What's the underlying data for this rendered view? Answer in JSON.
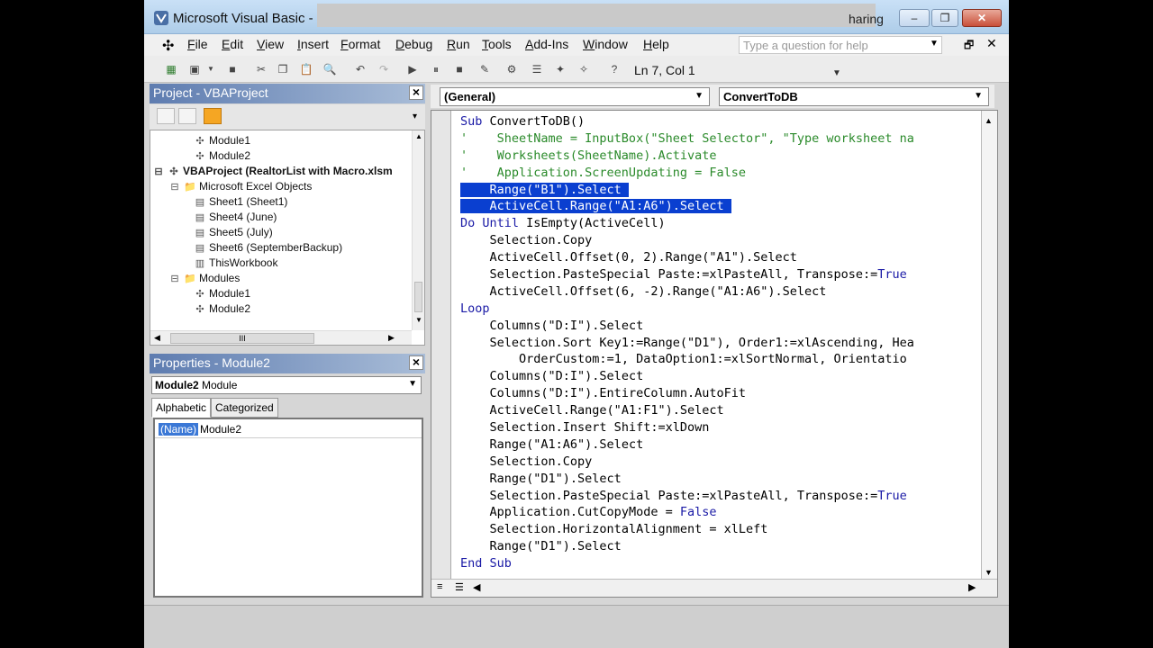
{
  "window": {
    "title": "Microsoft Visual Basic - R",
    "sharing_fragment": "haring",
    "minimize_label": "–",
    "maximize_label": "❐",
    "close_label": "✕"
  },
  "menu": {
    "items": [
      "File",
      "Edit",
      "View",
      "Insert",
      "Format",
      "Debug",
      "Run",
      "Tools",
      "Add-Ins",
      "Window",
      "Help"
    ],
    "help_placeholder": "Type a question for help"
  },
  "toolbar": {
    "cursor_position": "Ln 7, Col 1"
  },
  "project": {
    "title": "Project - VBAProject",
    "close_label": "×",
    "tree": [
      {
        "label": "Module1",
        "icon": "module-icon",
        "level": 3
      },
      {
        "label": "Module2",
        "icon": "module-icon",
        "level": 3
      },
      {
        "label": "VBAProject (RealtorList with Macro.xlsm",
        "icon": "vbaproject-icon",
        "level": 0,
        "bold": true,
        "expander": "⊟"
      },
      {
        "label": "Microsoft Excel Objects",
        "icon": "folder-icon",
        "level": 1,
        "expander": "⊟"
      },
      {
        "label": "Sheet1 (Sheet1)",
        "icon": "sheet-icon",
        "level": 2
      },
      {
        "label": "Sheet4 (June)",
        "icon": "sheet-icon",
        "level": 2
      },
      {
        "label": "Sheet5 (July)",
        "icon": "sheet-icon",
        "level": 2
      },
      {
        "label": "Sheet6 (SeptemberBackup)",
        "icon": "sheet-icon",
        "level": 2
      },
      {
        "label": "ThisWorkbook",
        "icon": "workbook-icon",
        "level": 2
      },
      {
        "label": "Modules",
        "icon": "folder-icon",
        "level": 1,
        "expander": "⊟"
      },
      {
        "label": "Module1",
        "icon": "module-icon",
        "level": 2
      },
      {
        "label": "Module2",
        "icon": "module-icon",
        "level": 2
      }
    ],
    "hscroll_thumb_label": "III"
  },
  "properties": {
    "title": "Properties - Module2",
    "close_label": "×",
    "object_bold": "Module2",
    "object_type": "Module",
    "tabs": [
      "Alphabetic",
      "Categorized"
    ],
    "name_key": "(Name)",
    "name_value": "Module2"
  },
  "code": {
    "object_combo": "(General)",
    "procedure_combo": "ConvertToDB",
    "lines": [
      {
        "indent": "",
        "parts": [
          {
            "t": "Sub ",
            "c": "kw"
          },
          {
            "t": "ConvertToDB()",
            "c": ""
          }
        ]
      },
      {
        "indent": "",
        "parts": [
          {
            "t": "'    SheetName = InputBox(\"Sheet Selector\", \"Type worksheet na",
            "c": "cm"
          }
        ]
      },
      {
        "indent": "",
        "parts": [
          {
            "t": "'    Worksheets(SheetName).Activate",
            "c": "cm"
          }
        ]
      },
      {
        "indent": "",
        "parts": [
          {
            "t": "'    Application.ScreenUpdating = False",
            "c": "cm"
          }
        ]
      },
      {
        "indent": "",
        "parts": [
          {
            "t": "    Range(\"B1\").Select ",
            "c": "sel"
          }
        ]
      },
      {
        "indent": "",
        "parts": [
          {
            "t": "    ActiveCell.Range(\"A1:A6\").Select ",
            "c": "sel"
          }
        ]
      },
      {
        "indent": "",
        "parts": [
          {
            "t": "Do Until ",
            "c": "kw"
          },
          {
            "t": "IsEmpty(ActiveCell)",
            "c": ""
          }
        ]
      },
      {
        "indent": "    ",
        "parts": [
          {
            "t": "Selection.Copy",
            "c": ""
          }
        ]
      },
      {
        "indent": "    ",
        "parts": [
          {
            "t": "ActiveCell.Offset(0, 2).Range(\"A1\").Select",
            "c": ""
          }
        ]
      },
      {
        "indent": "    ",
        "parts": [
          {
            "t": "Selection.PasteSpecial Paste:=xlPasteAll, Transpose:=",
            "c": ""
          },
          {
            "t": "True",
            "c": "kw"
          }
        ]
      },
      {
        "indent": "    ",
        "parts": [
          {
            "t": "ActiveCell.Offset(6, -2).Range(\"A1:A6\").Select",
            "c": ""
          }
        ]
      },
      {
        "indent": "",
        "parts": [
          {
            "t": "Loop",
            "c": "kw"
          }
        ]
      },
      {
        "indent": "    ",
        "parts": [
          {
            "t": "Columns(\"D:I\").Select",
            "c": ""
          }
        ]
      },
      {
        "indent": "    ",
        "parts": [
          {
            "t": "Selection.Sort Key1:=Range(\"D1\"), Order1:=xlAscending, Hea",
            "c": ""
          }
        ]
      },
      {
        "indent": "        ",
        "parts": [
          {
            "t": "OrderCustom:=1, DataOption1:=xlSortNormal, Orientatio",
            "c": ""
          }
        ]
      },
      {
        "indent": "    ",
        "parts": [
          {
            "t": "Columns(\"D:I\").Select",
            "c": ""
          }
        ]
      },
      {
        "indent": "    ",
        "parts": [
          {
            "t": "Columns(\"D:I\").EntireColumn.AutoFit",
            "c": ""
          }
        ]
      },
      {
        "indent": "    ",
        "parts": [
          {
            "t": "ActiveCell.Range(\"A1:F1\").Select",
            "c": ""
          }
        ]
      },
      {
        "indent": "    ",
        "parts": [
          {
            "t": "Selection.Insert Shift:=xlDown",
            "c": ""
          }
        ]
      },
      {
        "indent": "    ",
        "parts": [
          {
            "t": "Range(\"A1:A6\").Select",
            "c": ""
          }
        ]
      },
      {
        "indent": "    ",
        "parts": [
          {
            "t": "Selection.Copy",
            "c": ""
          }
        ]
      },
      {
        "indent": "    ",
        "parts": [
          {
            "t": "Range(\"D1\").Select",
            "c": ""
          }
        ]
      },
      {
        "indent": "    ",
        "parts": [
          {
            "t": "Selection.PasteSpecial Paste:=xlPasteAll, Transpose:=",
            "c": ""
          },
          {
            "t": "True",
            "c": "kw"
          }
        ]
      },
      {
        "indent": "    ",
        "parts": [
          {
            "t": "Application.CutCopyMode = ",
            "c": ""
          },
          {
            "t": "False",
            "c": "kw"
          }
        ]
      },
      {
        "indent": "    ",
        "parts": [
          {
            "t": "Selection.HorizontalAlignment = xlLeft",
            "c": ""
          }
        ]
      },
      {
        "indent": "    ",
        "parts": [
          {
            "t": "Range(\"D1\").Select",
            "c": ""
          }
        ]
      },
      {
        "indent": "",
        "parts": [
          {
            "t": "End Sub",
            "c": "kw"
          }
        ]
      }
    ]
  },
  "colors": {
    "keyword": "#1a1aa6",
    "comment": "#2a8a2a",
    "selection": "#0a3fd0",
    "panel_title": "#5e7cb0"
  }
}
